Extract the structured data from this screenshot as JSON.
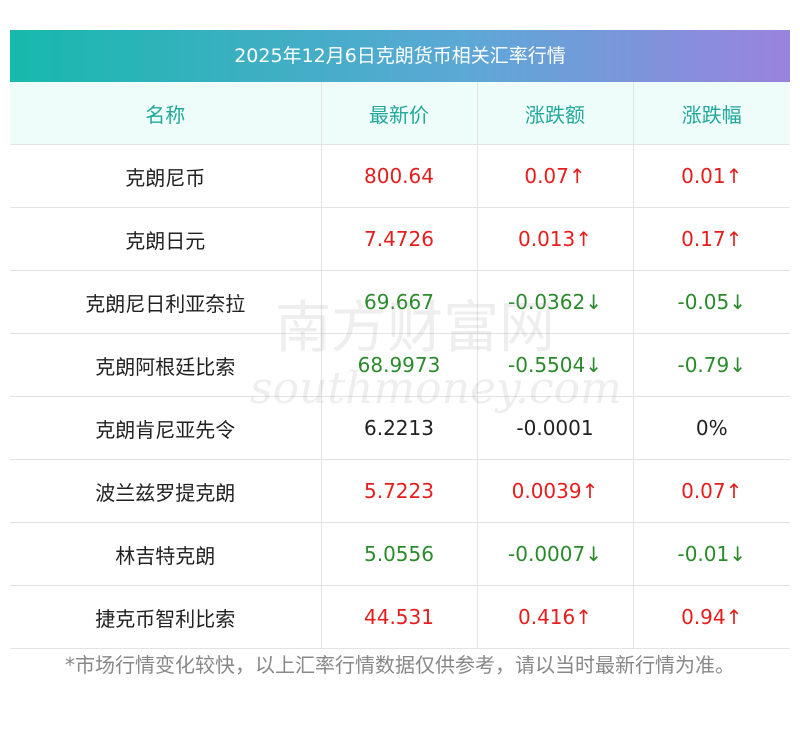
{
  "title": "2025年12月6日克朗货币相关汇率行情",
  "headers": [
    "名称",
    "最新价",
    "涨跌额",
    "涨跌幅"
  ],
  "rows": [
    {
      "name": "克朗尼币",
      "price": "800.64",
      "change": "0.07↑",
      "pct": "0.01↑",
      "trend": "up"
    },
    {
      "name": "克朗日元",
      "price": "7.4726",
      "change": "0.013↑",
      "pct": "0.17↑",
      "trend": "up"
    },
    {
      "name": "克朗尼日利亚奈拉",
      "price": "69.667",
      "change": "-0.0362↓",
      "pct": "-0.05↓",
      "trend": "down"
    },
    {
      "name": "克朗阿根廷比索",
      "price": "68.9973",
      "change": "-0.5504↓",
      "pct": "-0.79↓",
      "trend": "down"
    },
    {
      "name": "克朗肯尼亚先令",
      "price": "6.2213",
      "change": "-0.0001",
      "pct": "0%",
      "trend": "flat"
    },
    {
      "name": "波兰兹罗提克朗",
      "price": "5.7223",
      "change": "0.0039↑",
      "pct": "0.07↑",
      "trend": "up"
    },
    {
      "name": "林吉特克朗",
      "price": "5.0556",
      "change": "-0.0007↓",
      "pct": "-0.01↓",
      "trend": "down"
    },
    {
      "name": "捷克币智利比索",
      "price": "44.531",
      "change": "0.416↑",
      "pct": "0.94↑",
      "trend": "up"
    }
  ],
  "note": "*市场行情变化较快，以上汇率行情数据仅供参考，请以当时最新行情为准。",
  "watermark": {
    "cn": "南方财富网",
    "en": "southmoney.com"
  },
  "colors": {
    "up": "#e41e1e",
    "down": "#2b8a2b",
    "flat": "#222222",
    "header_text": "#22a99c",
    "header_bg": "#eefcfa"
  }
}
